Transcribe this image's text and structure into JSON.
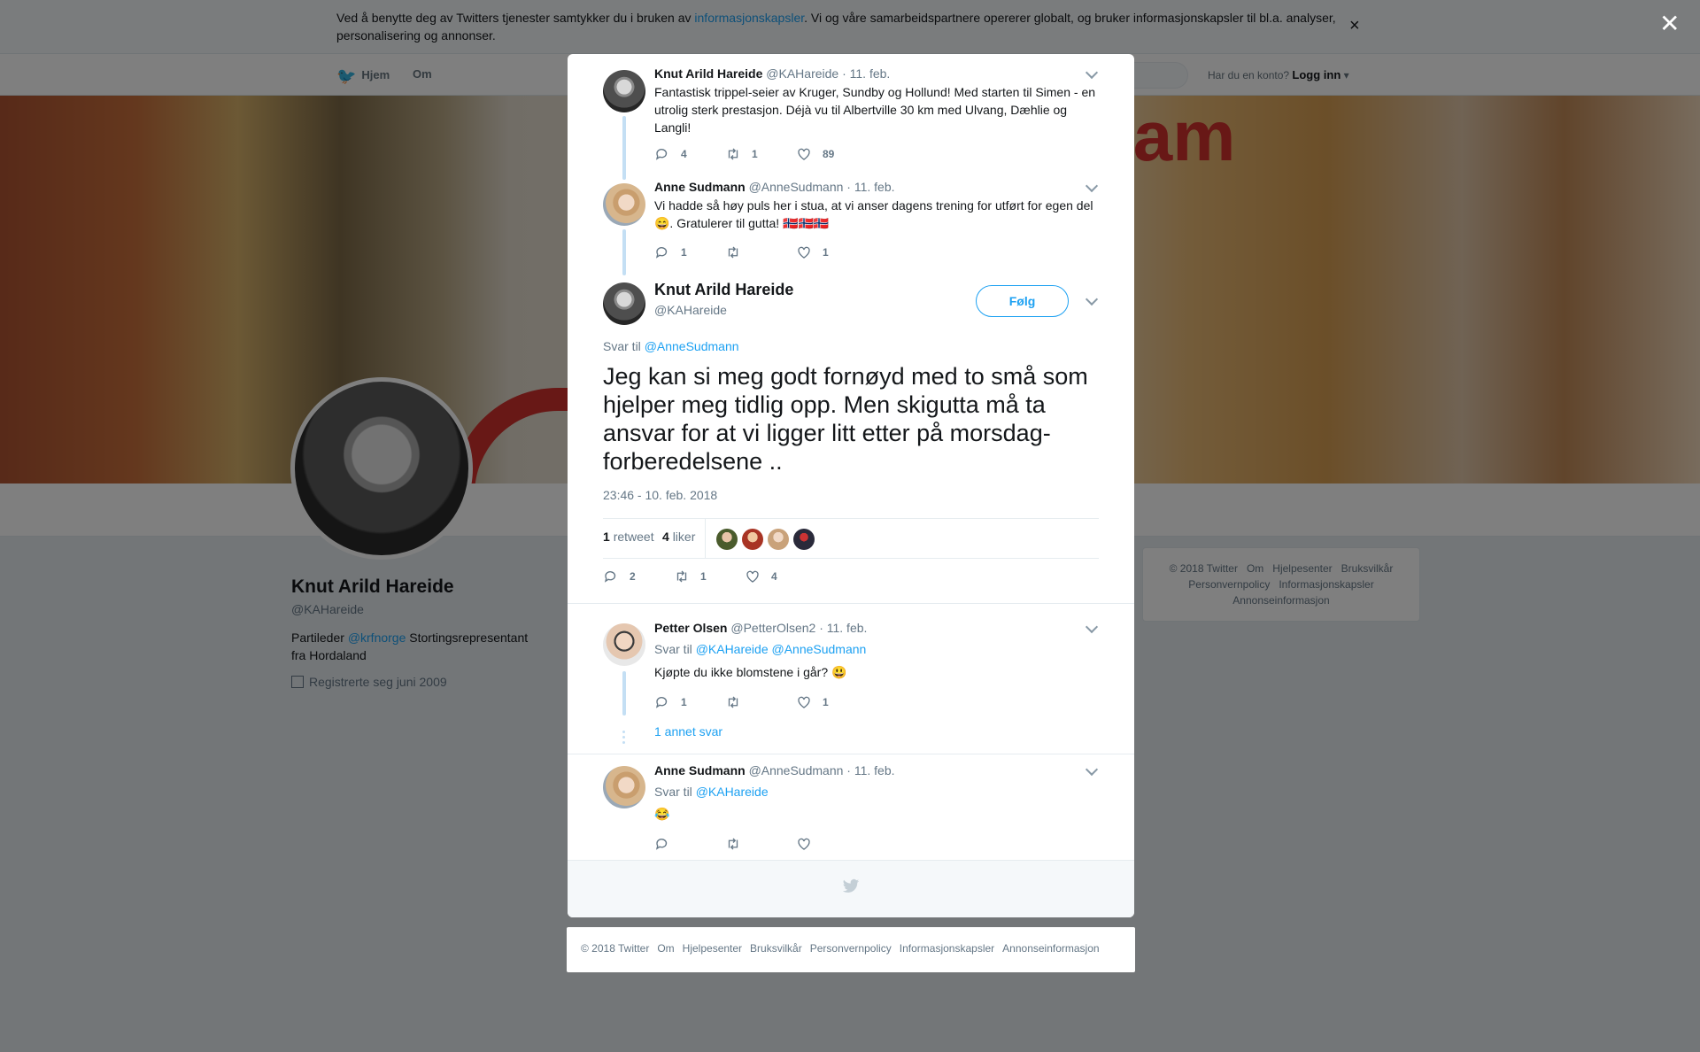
{
  "background": {
    "cookie_prefix": "Ved å benytte deg av Twitters tjenester samtykker du i bruken av ",
    "cookie_link": "informasjonskapsler",
    "cookie_suffix": ". Vi og våre samarbeidspartnere opererer globalt, og bruker informasjonskapsler til bl.a. analyser, personalisering og annonser.",
    "nav_home": "Hjem",
    "nav_about": "Om",
    "login_question": "Har du en konto?",
    "login_label": "Logg inn",
    "banner_text": "tram",
    "profile": {
      "name": "Knut Arild Hareide",
      "handle": "@KAHareide",
      "bio_prefix": "Partileder ",
      "bio_link": "@krfnorge",
      "bio_suffix": " Stortingsrepresentant fra Hordaland",
      "joined": "Registrerte seg juni 2009"
    },
    "side_footer": [
      "© 2018 Twitter",
      "Om",
      "Hjelpesenter",
      "Bruksvilkår",
      "Personvernpolicy",
      "Informasjonskapsler",
      "Annonseinformasjon"
    ]
  },
  "tweets": [
    {
      "name": "Knut Arild Hareide",
      "handle": "@KAHareide",
      "date": "· 11. feb.",
      "text": "Fantastisk trippel-seier av Kruger, Sundby og Hollund! Med starten til Simen - en utrolig sterk prestasjon. Déjà vu til Albertville 30 km med Ulvang, Dæhlie og Langli!",
      "replies": "4",
      "retweets": "1",
      "likes": "89"
    },
    {
      "name": "Anne Sudmann",
      "handle": "@AnneSudmann",
      "date": "· 11. feb.",
      "text": "Vi hadde så høy puls her i stua, at vi anser dagens trening for utført for egen del 😄. Gratulerer til gutta! 🇳🇴🇳🇴🇳🇴",
      "replies": "1",
      "retweets": "",
      "likes": "1"
    }
  ],
  "main_tweet": {
    "name": "Knut Arild Hareide",
    "handle": "@KAHareide",
    "follow_label": "Følg",
    "reply_prefix": "Svar til ",
    "reply_to": "@AnneSudmann",
    "text": "Jeg kan si meg godt fornøyd med to små som hjelper meg tidlig opp. Men skigutta må ta ansvar for at vi ligger litt etter på morsdag-forberedelsene ..",
    "timestamp": "23:46 - 10. feb. 2018",
    "retweet_count": "1",
    "retweet_label": "retweet",
    "like_count": "4",
    "like_label": "liker",
    "replies": "2",
    "retweets": "1",
    "likes": "4"
  },
  "replies": [
    {
      "name": "Petter Olsen",
      "handle": "@PetterOlsen2",
      "date": "· 11. feb.",
      "reply_prefix": "Svar til ",
      "reply_to": "@KAHareide @AnneSudmann",
      "text": "Kjøpte du ikke blomstene i går? 😃",
      "replies": "1",
      "retweets": "",
      "likes": "1",
      "more": "1 annet svar"
    },
    {
      "name": "Anne Sudmann",
      "handle": "@AnneSudmann",
      "date": "· 11. feb.",
      "reply_prefix": "Svar til ",
      "reply_to": "@KAHareide",
      "text": "😂",
      "replies": "",
      "retweets": "",
      "likes": ""
    }
  ],
  "footer": [
    "© 2018 Twitter",
    "Om",
    "Hjelpesenter",
    "Bruksvilkår",
    "Personvernpolicy",
    "Informasjonskapsler",
    "Annonseinformasjon"
  ],
  "colors": {
    "accent": "#1da1f2",
    "muted": "#657786",
    "thread": "#c4dff4"
  }
}
